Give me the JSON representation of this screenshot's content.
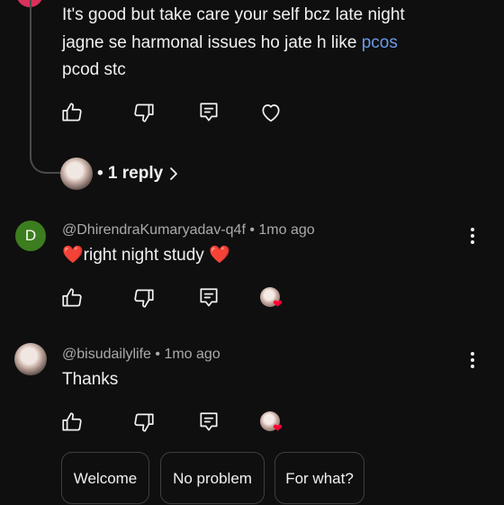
{
  "comment1": {
    "text_line1": "It's good but take care your self bcz late night",
    "text_line2_prefix": "jagne se harmonal issues ho jate h like ",
    "text_line2_link": "pcos",
    "text_line3": "pcod stc",
    "replies_label": "• 1 reply"
  },
  "comment2": {
    "avatar_letter": "D",
    "author": "@DhirendraKumaryadav-q4f",
    "age": "• 1mo ago",
    "text": "❤️right night study ❤️"
  },
  "comment3": {
    "author": "@bisudailylife",
    "age": "• 1mo ago",
    "text": "Thanks"
  },
  "suggestions": [
    "Welcome",
    "No problem",
    "For what?"
  ],
  "icons": {
    "like": "thumbs-up-icon",
    "dislike": "thumbs-down-icon",
    "reply": "reply-icon",
    "heart": "heart-icon",
    "more": "more-vertical-icon",
    "chevron": "chevron-right-icon"
  },
  "colors": {
    "background": "#0f0f0f",
    "text": "#f1f1f1",
    "muted": "#aaaaaa",
    "link": "#6b9ae8",
    "avatar_green": "#3c7d1f",
    "creator_heart": "#ff0033"
  }
}
